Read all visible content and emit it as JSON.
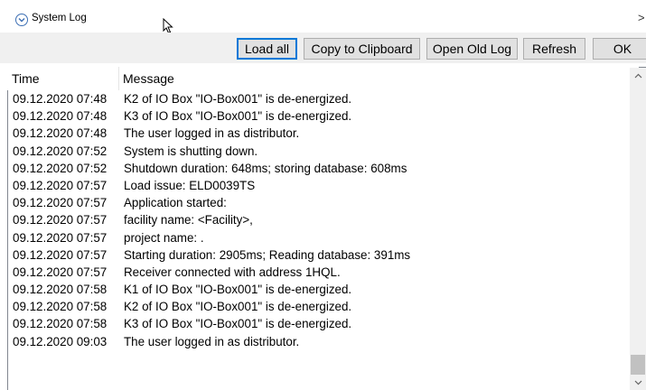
{
  "window": {
    "title": "System Log",
    "more_glyph": ">"
  },
  "toolbar": {
    "load_all": "Load all",
    "copy": "Copy to Clipboard",
    "open_old": "Open Old Log",
    "refresh": "Refresh",
    "ok": "OK"
  },
  "table": {
    "columns": {
      "time": "Time",
      "message": "Message"
    },
    "rows": [
      {
        "time": "09.12.2020 07:48",
        "message": "K2 of IO Box \"IO-Box001\" is de-energized."
      },
      {
        "time": "09.12.2020 07:48",
        "message": "K3 of IO Box \"IO-Box001\" is de-energized."
      },
      {
        "time": "09.12.2020 07:48",
        "message": "The user logged in as distributor."
      },
      {
        "time": "09.12.2020 07:52",
        "message": "System is shutting down."
      },
      {
        "time": "09.12.2020 07:52",
        "message": "Shutdown duration: 648ms; storing database: 608ms"
      },
      {
        "time": "09.12.2020 07:57",
        "message": "Load issue:  ELD0039TS"
      },
      {
        "time": "09.12.2020 07:57",
        "message": "Application started:"
      },
      {
        "time": "09.12.2020 07:57",
        "message": "facility name: <Facility>,"
      },
      {
        "time": "09.12.2020 07:57",
        "message": "project name: ."
      },
      {
        "time": "09.12.2020 07:57",
        "message": "Starting duration: 2905ms; Reading database: 391ms"
      },
      {
        "time": "09.12.2020 07:57",
        "message": "Receiver connected with address 1HQL."
      },
      {
        "time": "09.12.2020 07:58",
        "message": "K1 of IO Box \"IO-Box001\" is de-energized."
      },
      {
        "time": "09.12.2020 07:58",
        "message": "K2 of IO Box \"IO-Box001\" is de-energized."
      },
      {
        "time": "09.12.2020 07:58",
        "message": "K3 of IO Box \"IO-Box001\" is de-energized."
      },
      {
        "time": "09.12.2020 09:03",
        "message": "The user logged in as distributor."
      }
    ]
  },
  "icons": {
    "title": "window-app-icon",
    "cursor": "mouse-cursor-icon",
    "scroll_up": "chevron-up-icon",
    "scroll_down": "chevron-down-icon"
  }
}
